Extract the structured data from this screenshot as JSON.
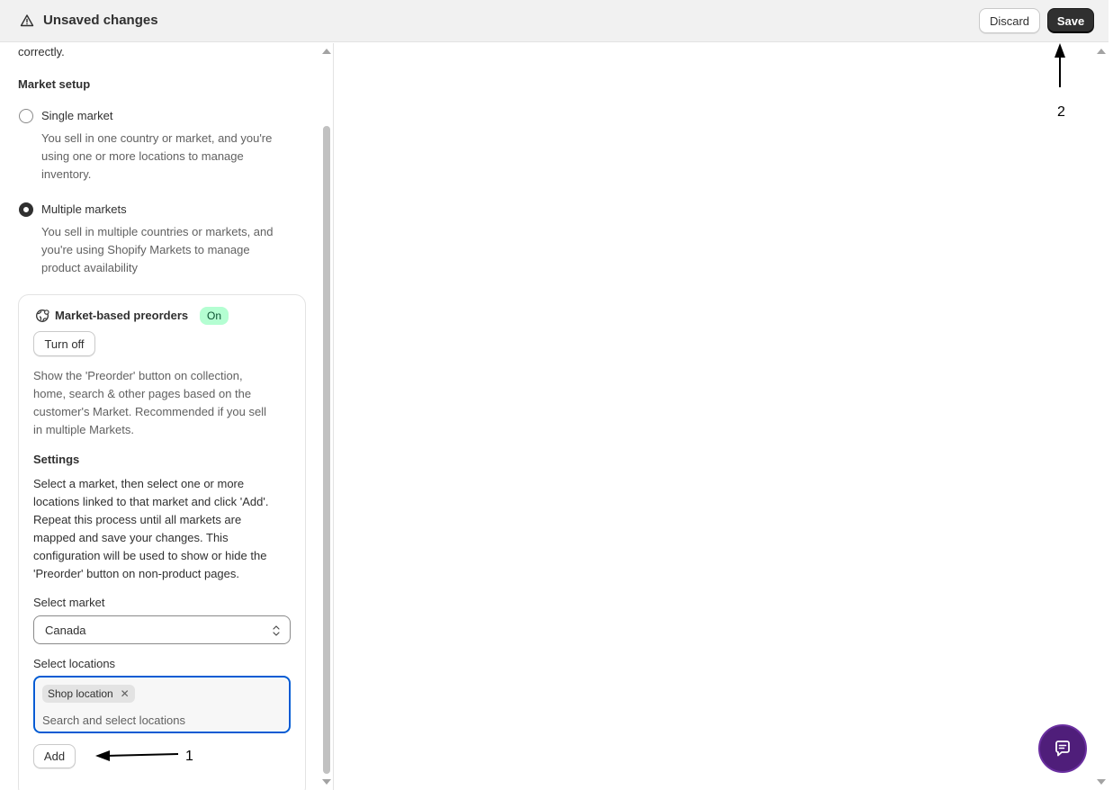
{
  "topbar": {
    "title": "Unsaved changes",
    "warning_icon": "alert-triangle-icon",
    "discard_label": "Discard",
    "save_label": "Save"
  },
  "left": {
    "clipped_text": "correctly.",
    "market_setup_heading": "Market setup",
    "options": [
      {
        "label": "Single market",
        "description_lines": [
          "You sell in one country or market, and you're",
          "using one or more locations to manage",
          "inventory."
        ],
        "checked": false
      },
      {
        "label": "Multiple markets",
        "description_lines": [
          "You sell in multiple countries or markets, and",
          "you're using Shopify Markets to manage",
          "product availability"
        ],
        "checked": true
      }
    ],
    "card": {
      "icon": "globe-icon",
      "title": "Market-based preorders",
      "badge": "On",
      "badge_color": "#b4fed2",
      "turn_off_label": "Turn off",
      "description_lines": [
        "Show the 'Preorder' button on collection,",
        "home, search & other pages based on the",
        "customer's Market. Recommended if you sell",
        "in multiple Markets."
      ],
      "settings_heading": "Settings",
      "settings_lines": [
        "Select a market, then select one or more",
        "locations linked to that market and click 'Add'.",
        "Repeat this process until all markets are",
        "mapped and save your changes. This",
        "configuration will be used to show or hide the",
        "'Preorder' button on non-product pages."
      ],
      "select_market_label": "Select market",
      "select_market_value": "Canada",
      "select_locations_label": "Select locations",
      "location_tag": "Shop location",
      "locations_placeholder": "Search and select locations",
      "add_label": "Add"
    }
  },
  "annotations": {
    "label_1": "1",
    "label_2": "2"
  },
  "chat": {
    "icon": "chat-bubble-icon",
    "color": "#4f1e7a"
  }
}
